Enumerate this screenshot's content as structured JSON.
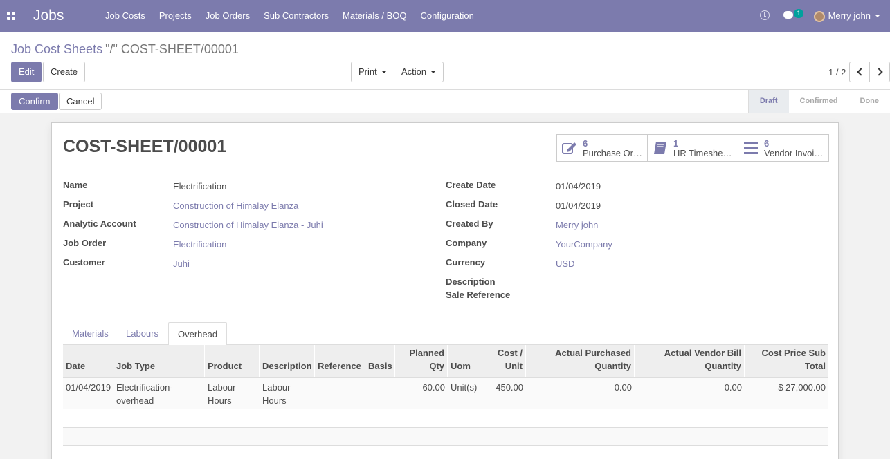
{
  "navbar": {
    "brand": "Jobs",
    "menu": [
      "Job Costs",
      "Projects",
      "Job Orders",
      "Sub Contractors",
      "Materials / BOQ",
      "Configuration"
    ],
    "chat_badge": "1",
    "user_name": "Merry john",
    "bg_color": "#7c7bad"
  },
  "breadcrumb": {
    "parent": "Job Cost Sheets",
    "current": "\"/\" COST-SHEET/00001"
  },
  "buttons": {
    "edit": "Edit",
    "create": "Create",
    "print": "Print",
    "action": "Action",
    "confirm": "Confirm",
    "cancel": "Cancel"
  },
  "pager": {
    "value": "1 / 2"
  },
  "stages": [
    {
      "label": "Draft",
      "active": true
    },
    {
      "label": "Confirmed",
      "active": false
    },
    {
      "label": "Done",
      "active": false
    }
  ],
  "sheet": {
    "title": "COST-SHEET/00001",
    "smart_buttons": [
      {
        "count": "6",
        "label": "Purchase Or…",
        "icon": "edit-icon"
      },
      {
        "count": "1",
        "label": "HR Timeshe…",
        "icon": "book-icon"
      },
      {
        "count": "6",
        "label": "Vendor Invoi…",
        "icon": "list-icon"
      }
    ],
    "left_fields": [
      {
        "label": "Name",
        "value": "Electrification",
        "link": false
      },
      {
        "label": "Project",
        "value": "Construction of Himalay Elanza",
        "link": true
      },
      {
        "label": "Analytic Account",
        "value": "Construction of Himalay Elanza - Juhi",
        "link": true
      },
      {
        "label": "Job Order",
        "value": "Electrification",
        "link": true
      },
      {
        "label": "Customer",
        "value": "Juhi",
        "link": true
      }
    ],
    "right_fields": [
      {
        "label": "Create Date",
        "value": "01/04/2019",
        "link": false
      },
      {
        "label": "Closed Date",
        "value": "01/04/2019",
        "link": false
      },
      {
        "label": "Created By",
        "value": "Merry john",
        "link": true
      },
      {
        "label": "Company",
        "value": "YourCompany",
        "link": true
      },
      {
        "label": "Currency",
        "value": "USD",
        "link": true
      },
      {
        "label": "Description",
        "value": "",
        "link": false
      },
      {
        "label": "Sale Reference",
        "value": "",
        "link": false
      }
    ],
    "tabs": [
      {
        "label": "Materials",
        "active": false
      },
      {
        "label": "Labours",
        "active": false
      },
      {
        "label": "Overhead",
        "active": true
      }
    ],
    "table": {
      "headers": [
        "Date",
        "Job Type",
        "Product",
        "Description",
        "Reference",
        "Basis",
        "Planned Qty",
        "Uom",
        "Cost / Unit",
        "Actual Purchased Quantity",
        "Actual Vendor Bill Quantity",
        "Cost Price Sub Total"
      ],
      "rows": [
        {
          "date": "01/04/2019",
          "job_type": "Electrification-overhead",
          "product": "Labour Hours",
          "description": "Labour Hours",
          "reference": "",
          "basis": "",
          "planned_qty": "60.00",
          "uom": "Unit(s)",
          "cost_unit": "450.00",
          "actual_purchased_qty": "0.00",
          "actual_vendor_bill_qty": "0.00",
          "subtotal": "$ 27,000.00"
        }
      ]
    }
  }
}
